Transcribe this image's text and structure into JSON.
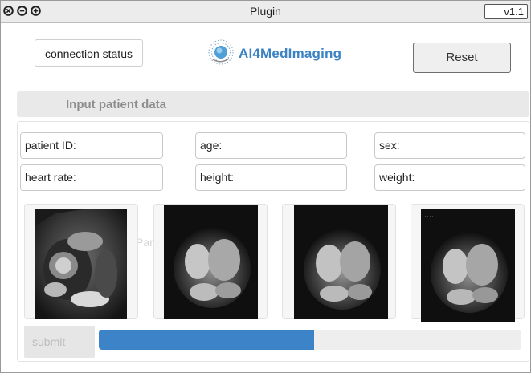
{
  "window": {
    "title": "Plugin",
    "version": "v1.1",
    "buttons": [
      "close",
      "minimize",
      "maximize"
    ]
  },
  "header": {
    "connection_status_label": "connection status",
    "logo_text": "AI4MedImaging",
    "reset_label": "Reset"
  },
  "section": {
    "title": "Input patient data"
  },
  "fields": {
    "patient_id": "patient ID:",
    "age": "age:",
    "sex": "sex:",
    "heart_rate": "heart rate:",
    "height": "height:",
    "weight": "weight:"
  },
  "ghost_text": "Par",
  "images": [
    {
      "name": "cardiac-mri-short-axis-image",
      "alt": "short-axis cardiac MRI"
    },
    {
      "name": "cardiac-mri-four-chamber-image-1",
      "alt": "four-chamber cardiac MRI"
    },
    {
      "name": "cardiac-mri-four-chamber-image-2",
      "alt": "four-chamber cardiac MRI"
    },
    {
      "name": "cardiac-mri-four-chamber-image-3",
      "alt": "four-chamber cardiac MRI"
    }
  ],
  "submit_label": "submit",
  "progress": {
    "fraction": 0.51
  },
  "colors": {
    "accent": "#3c83c7",
    "logo": "#3c83c4",
    "header_bg": "#e9e9e9",
    "disabled_text": "#bdbdbd"
  }
}
